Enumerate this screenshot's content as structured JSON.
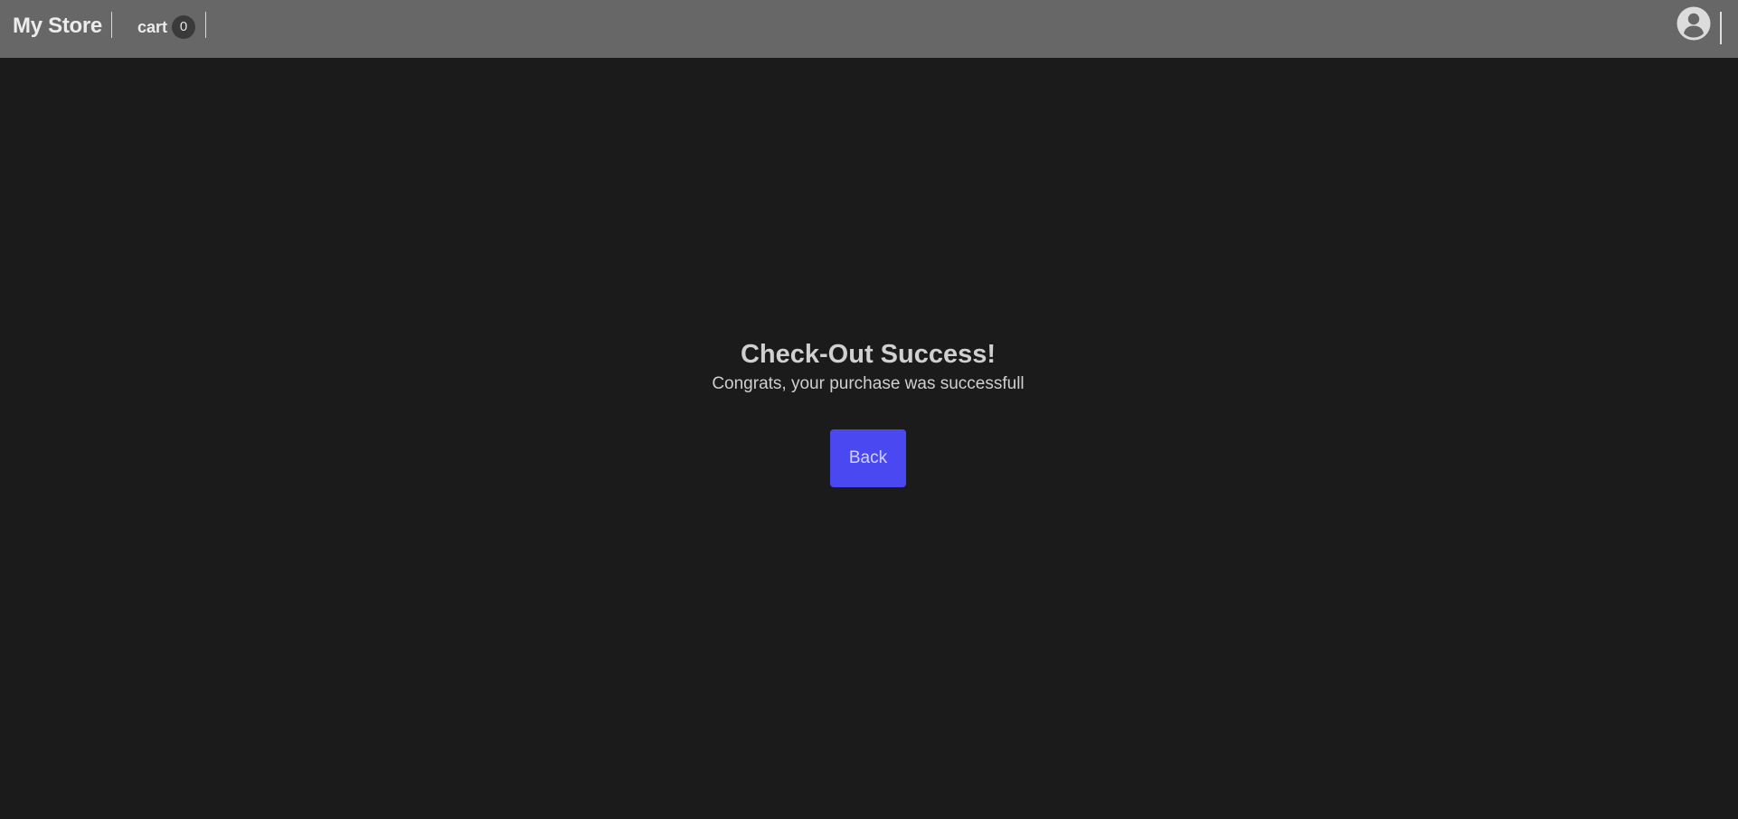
{
  "header": {
    "brand": "My Store",
    "cart_label": "cart",
    "cart_count": "0",
    "profile_icon": "account-circle-icon"
  },
  "main": {
    "title": "Check-Out Success!",
    "message": "Congrats, your purchase was successfull",
    "back_button_label": "Back"
  },
  "colors": {
    "page_background": "#1b1b1b",
    "navbar_background": "#676767",
    "button_accent": "#4a48f0"
  }
}
